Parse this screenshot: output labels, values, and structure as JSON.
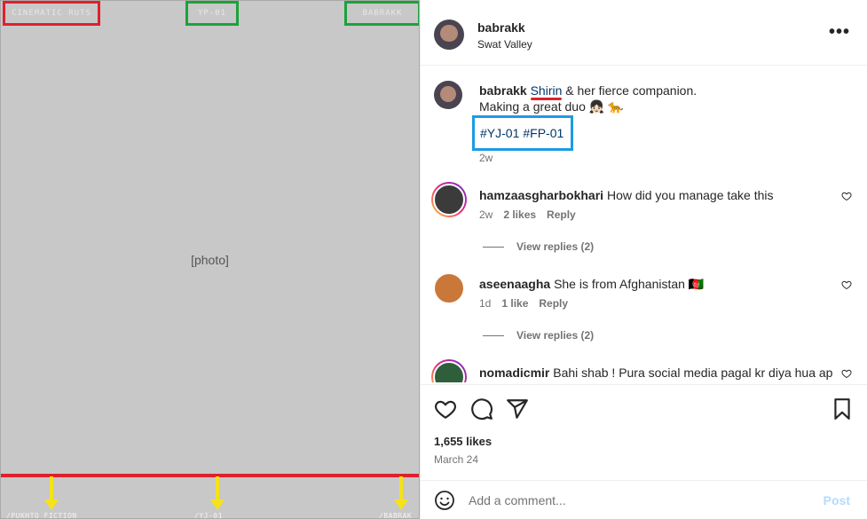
{
  "image": {
    "placeholder": "[photo]",
    "top_watermarks": [
      "CINEMATIC RUTS",
      "YP-01",
      "BABRAKK"
    ],
    "bottom_overlay": [
      "/PUKHTO FICTION",
      "/YJ-01",
      "/BABRAK"
    ]
  },
  "header": {
    "username": "babrakk",
    "location": "Swat Valley",
    "more_icon": "more-horizontal-icon"
  },
  "caption": {
    "username": "babrakk",
    "mention": "Shirin",
    "text_line1_rest": " & her fierce companion.",
    "text_line2": "Making a great duo 👧🏻 🐆",
    "hashtags": [
      "#YJ-01",
      "#FP-01"
    ],
    "time": "2w"
  },
  "comments": [
    {
      "username": "hamzaasgharbokhari",
      "text": "How did you manage take this",
      "time": "2w",
      "likes": "2 likes",
      "reply": "Reply",
      "view_replies": "View replies (2)"
    },
    {
      "username": "aseenaagha",
      "text": "She is from Afghanistan 🇦🇫",
      "time": "1d",
      "likes": "1 like",
      "reply": "Reply",
      "view_replies": "View replies (2)"
    },
    {
      "username": "nomadicmir",
      "text": "Bahi shab ! Pura social media pagal kr diya hua ap"
    }
  ],
  "actions": {
    "likes": "1,655 likes",
    "date": "March 24"
  },
  "add_comment": {
    "placeholder": "Add a comment...",
    "post_label": "Post"
  },
  "colors": {
    "annotation_red": "#e0202d",
    "annotation_green": "#1aa33a",
    "annotation_blue": "#1d9be5",
    "annotation_yellow": "#f5e21b",
    "link": "#00376b",
    "secondary_text": "#737373"
  }
}
